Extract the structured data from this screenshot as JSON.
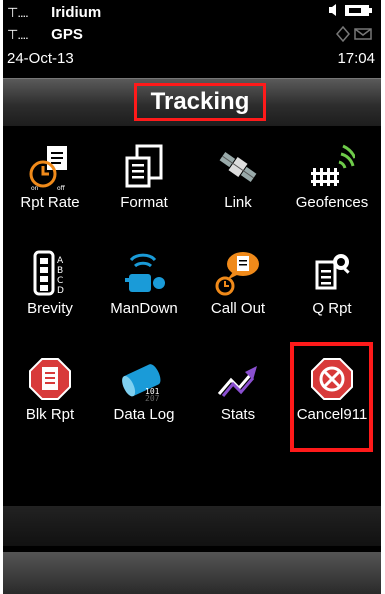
{
  "status": {
    "network1_icon": "antenna-icon",
    "network1_bars": "....",
    "network1": "Iridium",
    "network2_bars": "....",
    "network2": "GPS",
    "date": "24-Oct-13",
    "time": "17:04"
  },
  "header": {
    "title": "Tracking"
  },
  "tiles": [
    {
      "label": "Rpt Rate",
      "icon": "report-rate-icon"
    },
    {
      "label": "Format",
      "icon": "format-icon"
    },
    {
      "label": "Link",
      "icon": "satellite-link-icon"
    },
    {
      "label": "Geofences",
      "icon": "geofence-icon"
    },
    {
      "label": "Brevity",
      "icon": "brevity-icon"
    },
    {
      "label": "ManDown",
      "icon": "man-down-icon"
    },
    {
      "label": "Call Out",
      "icon": "call-out-icon"
    },
    {
      "label": "Q Rpt",
      "icon": "quick-report-icon"
    },
    {
      "label": "Blk Rpt",
      "icon": "block-report-icon"
    },
    {
      "label": "Data Log",
      "icon": "data-log-icon"
    },
    {
      "label": "Stats",
      "icon": "stats-icon"
    },
    {
      "label": "Cancel911",
      "icon": "cancel-911-icon"
    }
  ],
  "brevity_letters": [
    "A",
    "B",
    "C",
    "D"
  ],
  "datalog_bits": [
    "101",
    "207"
  ],
  "colors": {
    "highlight": "#ff1a1a",
    "orange": "#f08a1a",
    "blue": "#1a9bd8",
    "purple": "#8a4fd0"
  }
}
